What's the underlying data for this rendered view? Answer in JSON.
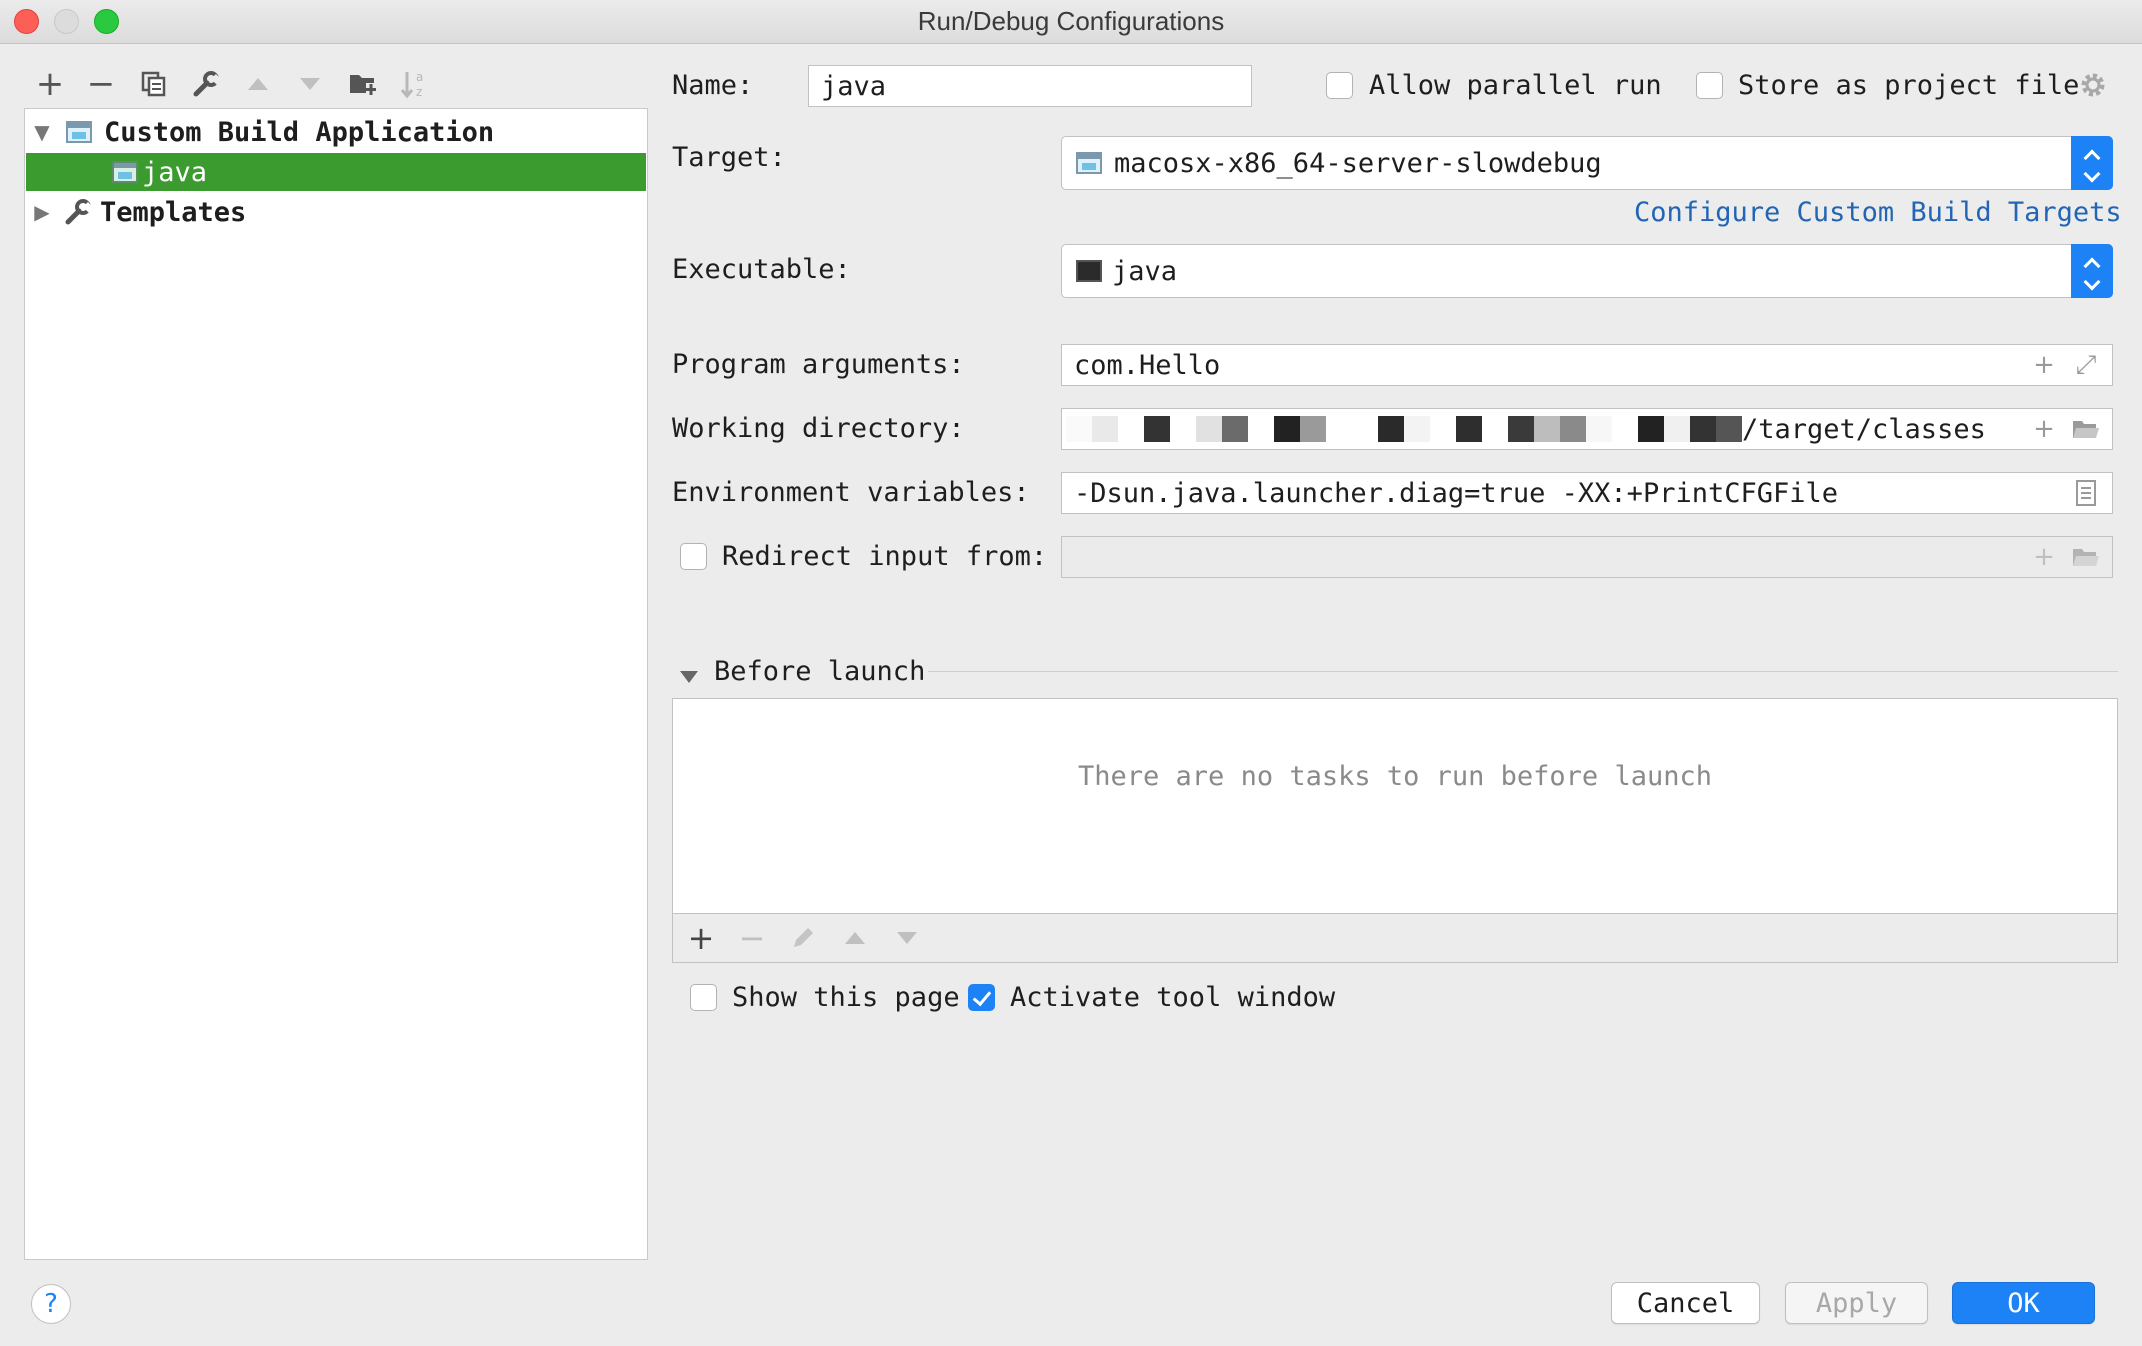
{
  "window": {
    "title": "Run/Debug Configurations"
  },
  "left_toolbar": {
    "icons": [
      "add-icon",
      "remove-icon",
      "copy-icon",
      "wrench-icon",
      "move-up-icon",
      "move-down-icon",
      "new-folder-icon",
      "sort-icon"
    ],
    "add_glyph": "+",
    "remove_glyph": "−"
  },
  "tree": {
    "items": [
      {
        "label": "Custom Build Application",
        "expanded": true
      },
      {
        "label": "java",
        "selected": true
      },
      {
        "label": "Templates",
        "expanded": false
      }
    ]
  },
  "form": {
    "name_label": "Name:",
    "name_value": "java",
    "allow_parallel_label": "Allow parallel run",
    "allow_parallel_checked": false,
    "store_project_label": "Store as project file",
    "store_project_checked": false,
    "target_label": "Target:",
    "target_value": "macosx-x86_64-server-slowdebug",
    "configure_link": "Configure Custom Build Targets",
    "executable_label": "Executable:",
    "executable_value": "java",
    "program_args_label": "Program arguments:",
    "program_args_value": "com.Hello",
    "working_dir_label": "Working directory:",
    "working_dir_value": "/target/classes",
    "env_vars_label": "Environment variables:",
    "env_vars_value": "-Dsun.java.launcher.diag=true -XX:+PrintCFGFile",
    "redirect_label": "Redirect input from:",
    "redirect_checked": false,
    "redirect_value": ""
  },
  "before_launch": {
    "header": "Before launch",
    "empty_text": "There are no tasks to run before launch",
    "add_glyph": "+",
    "remove_glyph": "−",
    "show_page_label": "Show this page",
    "show_page_checked": false,
    "activate_label": "Activate tool window",
    "activate_checked": true
  },
  "buttons": {
    "help": "?",
    "cancel": "Cancel",
    "apply": "Apply",
    "ok": "OK"
  },
  "colors": {
    "selection": "#3b9b2f",
    "accent": "#1d82f5",
    "link": "#2265b5"
  }
}
